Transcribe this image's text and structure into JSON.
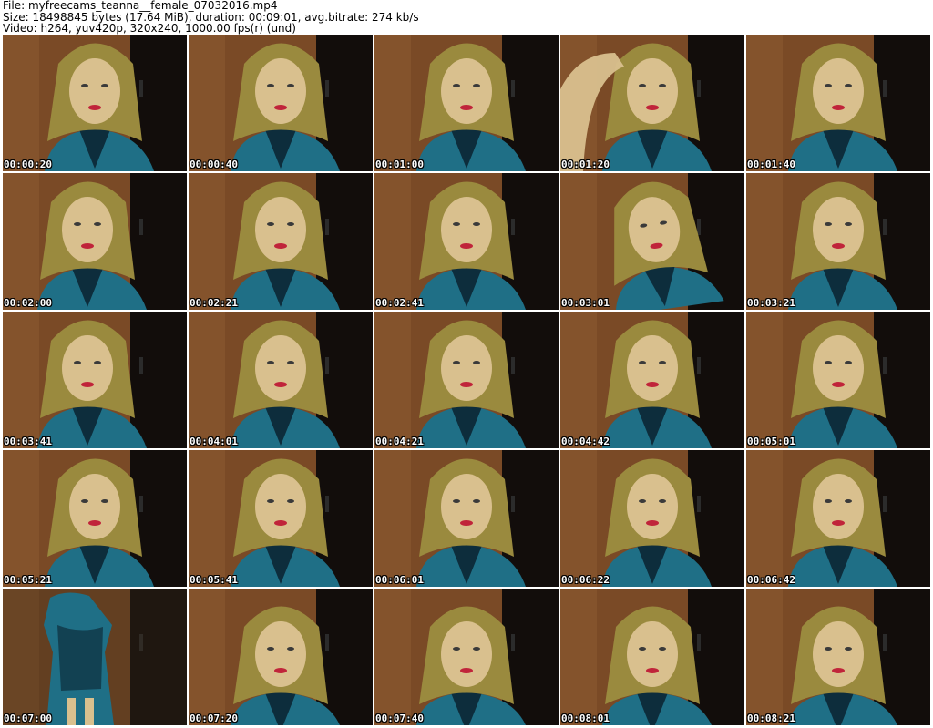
{
  "header": {
    "file_line": "File: myfreecams_teanna__female_07032016.mp4",
    "size_line": "Size: 18498845 bytes (17.64 MiB), duration: 00:09:01, avg.bitrate: 274 kb/s",
    "video_line": "Video: h264, yuv420p, 320x240, 1000.00 fps(r) (und)"
  },
  "frames": [
    {
      "timestamp": "00:00:20",
      "pose": "center"
    },
    {
      "timestamp": "00:00:40",
      "pose": "center"
    },
    {
      "timestamp": "00:01:00",
      "pose": "center"
    },
    {
      "timestamp": "00:01:20",
      "pose": "arm-raised"
    },
    {
      "timestamp": "00:01:40",
      "pose": "center"
    },
    {
      "timestamp": "00:02:00",
      "pose": "left"
    },
    {
      "timestamp": "00:02:21",
      "pose": "center"
    },
    {
      "timestamp": "00:02:41",
      "pose": "center"
    },
    {
      "timestamp": "00:03:01",
      "pose": "tilt"
    },
    {
      "timestamp": "00:03:21",
      "pose": "center"
    },
    {
      "timestamp": "00:03:41",
      "pose": "left"
    },
    {
      "timestamp": "00:04:01",
      "pose": "center"
    },
    {
      "timestamp": "00:04:21",
      "pose": "center"
    },
    {
      "timestamp": "00:04:42",
      "pose": "center"
    },
    {
      "timestamp": "00:05:01",
      "pose": "center"
    },
    {
      "timestamp": "00:05:21",
      "pose": "center"
    },
    {
      "timestamp": "00:05:41",
      "pose": "center"
    },
    {
      "timestamp": "00:06:01",
      "pose": "center"
    },
    {
      "timestamp": "00:06:22",
      "pose": "center"
    },
    {
      "timestamp": "00:06:42",
      "pose": "center"
    },
    {
      "timestamp": "00:07:00",
      "pose": "standing"
    },
    {
      "timestamp": "00:07:20",
      "pose": "low"
    },
    {
      "timestamp": "00:07:40",
      "pose": "low"
    },
    {
      "timestamp": "00:08:01",
      "pose": "low"
    },
    {
      "timestamp": "00:08:21",
      "pose": "low"
    }
  ],
  "colors": {
    "wall": "#7a4a26",
    "door_dark": "#120d0b",
    "hair": "#9a8a3e",
    "skin": "#d9c08e",
    "robe": "#1f6f86",
    "robe_shadow": "#0d2d3c",
    "lips": "#c0243a"
  }
}
